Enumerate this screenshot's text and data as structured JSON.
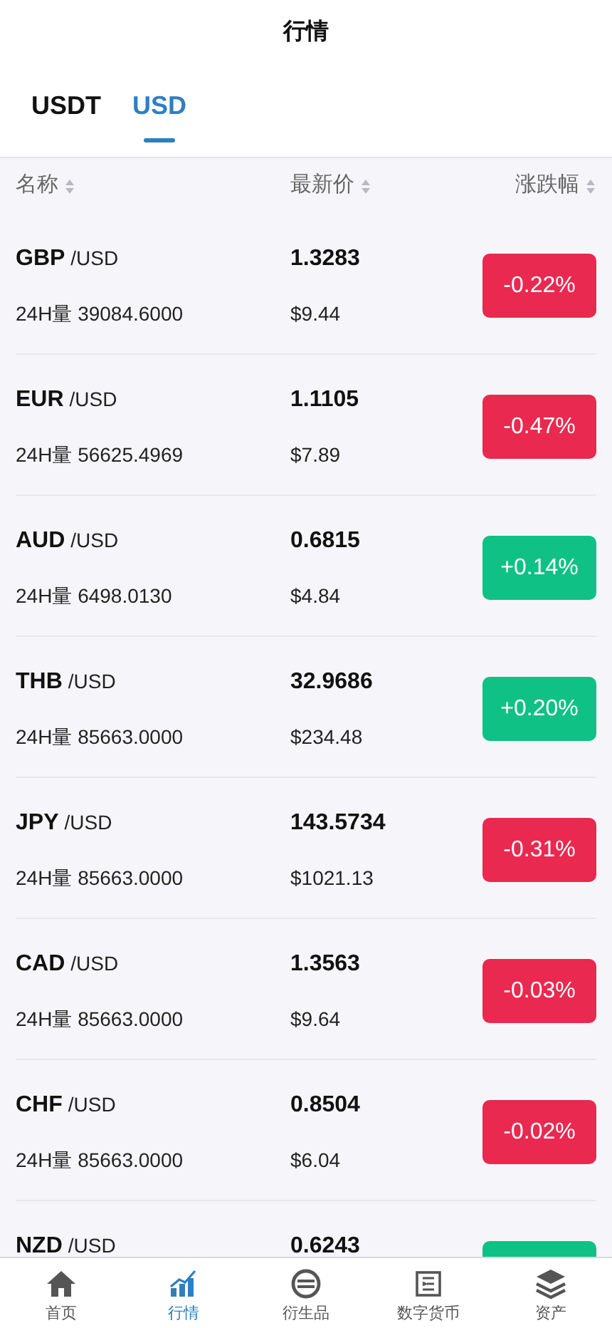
{
  "title": "行情",
  "tabs": [
    {
      "label": "USDT",
      "selected": false
    },
    {
      "label": "USD",
      "selected": true
    }
  ],
  "columns": [
    "名称",
    "最新价",
    "涨跌幅"
  ],
  "rows": [
    {
      "base": "GBP",
      "quote": "/USD",
      "volume": "24H量 39084.6000",
      "price": "1.3283",
      "usd": "$9.44",
      "change": "-0.22%",
      "kind": "down"
    },
    {
      "base": "EUR",
      "quote": "/USD",
      "volume": "24H量 56625.4969",
      "price": "1.1105",
      "usd": "$7.89",
      "change": "-0.47%",
      "kind": "down"
    },
    {
      "base": "AUD",
      "quote": "/USD",
      "volume": "24H量 6498.0130",
      "price": "0.6815",
      "usd": "$4.84",
      "change": "+0.14%",
      "kind": "up"
    },
    {
      "base": "THB",
      "quote": "/USD",
      "volume": "24H量 85663.0000",
      "price": "32.9686",
      "usd": "$234.48",
      "change": "+0.20%",
      "kind": "up"
    },
    {
      "base": "JPY",
      "quote": "/USD",
      "volume": "24H量 85663.0000",
      "price": "143.5734",
      "usd": "$1021.13",
      "change": "-0.31%",
      "kind": "down"
    },
    {
      "base": "CAD",
      "quote": "/USD",
      "volume": "24H量 85663.0000",
      "price": "1.3563",
      "usd": "$9.64",
      "change": "-0.03%",
      "kind": "down"
    },
    {
      "base": "CHF",
      "quote": "/USD",
      "volume": "24H量 85663.0000",
      "price": "0.8504",
      "usd": "$6.04",
      "change": "-0.02%",
      "kind": "down"
    },
    {
      "base": "NZD",
      "quote": "/USD",
      "price": "0.6243",
      "kind": "up"
    }
  ],
  "nav": [
    {
      "label": "首页",
      "selected": false
    },
    {
      "label": "行情",
      "selected": true
    },
    {
      "label": "衍生品",
      "selected": false
    },
    {
      "label": "数字货币",
      "selected": false
    },
    {
      "label": "资产",
      "selected": false
    }
  ]
}
